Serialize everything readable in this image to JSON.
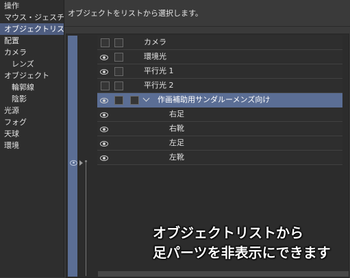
{
  "sidebar": {
    "items": [
      {
        "label": "操作"
      },
      {
        "label": "マウス・ジェスチャー"
      },
      {
        "label": "オブジェクトリスト",
        "selected": true
      },
      {
        "label": "配置"
      },
      {
        "label": "カメラ"
      },
      {
        "label": "レンズ",
        "sub": true
      },
      {
        "label": "オブジェクト"
      },
      {
        "label": "輪郭線",
        "sub": true
      },
      {
        "label": "陰影",
        "sub": true
      },
      {
        "label": "光源"
      },
      {
        "label": "フォグ"
      },
      {
        "label": "天球"
      },
      {
        "label": "環境"
      }
    ]
  },
  "panel": {
    "description": "オブジェクトをリストから選択します。"
  },
  "object_list": {
    "rows": [
      {
        "label": "カメラ",
        "eye": false,
        "check1": true,
        "check2": true
      },
      {
        "label": "環境光",
        "eye": true,
        "check1": false,
        "check2": true
      },
      {
        "label": "平行光 1",
        "eye": true,
        "check1": false,
        "check2": true
      },
      {
        "label": "平行光 2",
        "eye": false,
        "check1": true,
        "check2": true
      },
      {
        "label": "作画補助用サンダルーメンズ向け",
        "eye": true,
        "check1": false,
        "check2": true,
        "check3": true,
        "expanded": true,
        "selected": true
      },
      {
        "label": "右足",
        "eye": true,
        "indent": true
      },
      {
        "label": "右靴",
        "eye": true,
        "indent": true
      },
      {
        "label": "左足",
        "eye": true,
        "indent": true
      },
      {
        "label": "左靴",
        "eye": true,
        "indent": true
      }
    ]
  },
  "caption": {
    "line1": "オブジェクトリストから",
    "line2": "足パーツを非表示にできます"
  },
  "colors": {
    "selection": "#5b6e95",
    "sidebar_selected": "#4e5d80",
    "background": "#3a3a3a"
  },
  "icons": {
    "eye": "eye-icon",
    "expand": "chevron-down-icon"
  }
}
